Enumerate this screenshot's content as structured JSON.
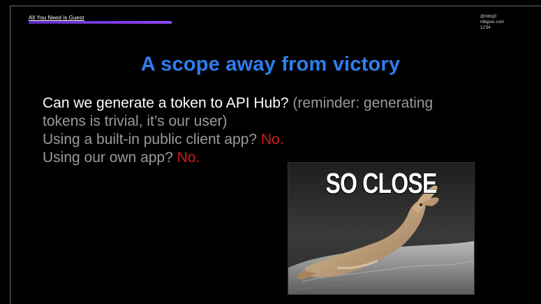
{
  "header": {
    "title": "All You Need is Guest",
    "speaker_lines": [
      "@mbrg0",
      "mbgsec.com",
      "12'34"
    ]
  },
  "slide": {
    "title": "A scope away from victory",
    "lines": [
      {
        "main": "Can we generate a token to API Hub?",
        "note": " (reminder: generating"
      },
      {
        "note": "tokens is trivial, it’s our user)"
      },
      {
        "main": "Using a built-in public client app? ",
        "answer": "No."
      },
      {
        "main": "Using our own app? ",
        "answer": "No."
      }
    ]
  },
  "meme": {
    "caption": "SO CLOSE",
    "description_icon": "prairie-dog-reaching-image"
  },
  "colors": {
    "title": "#2e7ef0",
    "answer": "#d21a1a",
    "accent_bar": "#7b3ae0"
  }
}
